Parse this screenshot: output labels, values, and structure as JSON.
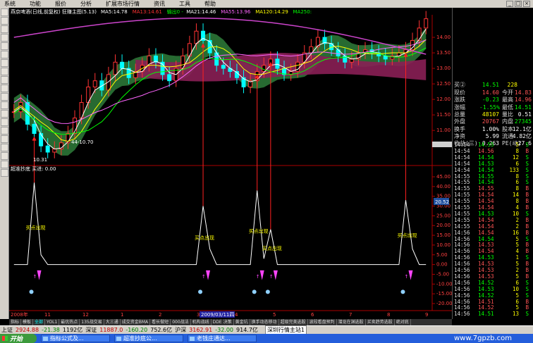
{
  "menu": {
    "items": [
      "系统",
      "功能",
      "报价",
      "分析",
      "扩展市场行情",
      "资讯",
      "工具",
      "帮助"
    ]
  },
  "window_buttons": [
    "_",
    "□",
    "×"
  ],
  "main_chart": {
    "title": "燕京啤酒(日线,前复权) 狂赚主图(5.13)",
    "ma_legend": [
      {
        "label": "MA5:14.78",
        "color": "#ffffff"
      },
      {
        "label": "MA13:14.61",
        "color": "#ff3333"
      },
      {
        "label": "输出0 -",
        "color": "#00ff00"
      },
      {
        "label": "MA21:14.46",
        "color": "#ffffff"
      },
      {
        "label": "MA55:13.96",
        "color": "#ff66ff"
      },
      {
        "label": "MA120:14.29",
        "color": "#ffff00"
      },
      {
        "label": "MA250:",
        "color": "#00ff00"
      }
    ],
    "annotation_low": "44-10.70",
    "annotation_low2": "10.31",
    "price_axis": [
      "14.00",
      "13.50",
      "13.00",
      "12.50",
      "12.00",
      "11.50",
      "11.00",
      "10.50"
    ]
  },
  "indicator": {
    "title": "超准抄底 买进: 0.00",
    "signal_label": "买点出现",
    "axis": [
      "45.00",
      "40.00",
      "35.00",
      "30.00",
      "25.00",
      "20.00",
      "15.00",
      "10.00",
      "5.00",
      "0.00",
      "-5.00",
      "-10.00",
      "-15.00",
      "-20.00"
    ],
    "current_value": "20.52"
  },
  "date_axis": {
    "left_label": "2008年",
    "months": [
      "11",
      "12",
      "1",
      "2",
      "3",
      "4",
      "5",
      "6",
      "7",
      "8",
      "9"
    ],
    "cursor_date": "2009/03/11四"
  },
  "quote": {
    "bid_label": "买②",
    "bid_price": "14.51",
    "bid_vol": "228",
    "rows": [
      {
        "l1": "现价",
        "v1": "14.60",
        "c1": "#ff5555",
        "l2": "今开",
        "v2": "14.83",
        "c2": "#ff5555"
      },
      {
        "l1": "涨跌",
        "v1": "-0.23",
        "c1": "#00ff00",
        "l2": "最高",
        "v2": "14.96",
        "c2": "#ff5555"
      },
      {
        "l1": "涨幅",
        "v1": "-1.55%",
        "c1": "#00ff00",
        "l2": "最低",
        "v2": "14.51",
        "c2": "#00ff00"
      },
      {
        "l1": "总量",
        "v1": "48107",
        "c1": "#ffff00",
        "l2": "量比",
        "v2": "0.51",
        "c2": "#ffffff"
      },
      {
        "l1": "外盘",
        "v1": "20767",
        "c1": "#ff5555",
        "l2": "内盘",
        "v2": "27345",
        "c2": "#00ff00"
      },
      {
        "l1": "换手",
        "v1": "1.00%",
        "c1": "#ffffff",
        "l2": "股本",
        "v2": "12.1亿",
        "c2": "#ffffff"
      },
      {
        "l1": "净资",
        "v1": "5.99",
        "c1": "#ffffff",
        "l2": "流通",
        "v2": "4.82亿",
        "c2": "#ffffff"
      },
      {
        "l1": "收益(三)",
        "v1": "0.263",
        "c1": "#ffffff",
        "l2": "PE(动)",
        "v2": "27.6",
        "c2": "#ffffff"
      }
    ],
    "ticks": [
      {
        "t": "14:54",
        "p": "14.55",
        "v": "5",
        "bs": "S",
        "c": "#00ff00"
      },
      {
        "t": "14:54",
        "p": "14.56",
        "v": "8",
        "bs": "B",
        "c": "#ff5555"
      },
      {
        "t": "14:54",
        "p": "14.54",
        "v": "12",
        "bs": "S",
        "c": "#00ff00"
      },
      {
        "t": "14:54",
        "p": "14.53",
        "v": "6",
        "bs": "S",
        "c": "#00ff00"
      },
      {
        "t": "14:54",
        "p": "14.54",
        "v": "133",
        "bs": "S",
        "c": "#00ff00"
      },
      {
        "t": "14:55",
        "p": "14.55",
        "v": "8",
        "bs": "S",
        "c": "#00ff00"
      },
      {
        "t": "14:55",
        "p": "14.54",
        "v": "6",
        "bs": "S",
        "c": "#00ff00"
      },
      {
        "t": "14:55",
        "p": "14.55",
        "v": "8",
        "bs": "B",
        "c": "#ff5555"
      },
      {
        "t": "14:55",
        "p": "14.54",
        "v": "14",
        "bs": "B",
        "c": "#ff5555"
      },
      {
        "t": "14:55",
        "p": "14.54",
        "v": "8",
        "bs": "B",
        "c": "#ff5555"
      },
      {
        "t": "14:55",
        "p": "14.54",
        "v": "4",
        "bs": "B",
        "c": "#ff5555"
      },
      {
        "t": "14:55",
        "p": "14.53",
        "v": "10",
        "bs": "S",
        "c": "#00ff00"
      },
      {
        "t": "14:55",
        "p": "14.54",
        "v": "2",
        "bs": "B",
        "c": "#ff5555"
      },
      {
        "t": "14:55",
        "p": "14.54",
        "v": "2",
        "bs": "B",
        "c": "#ff5555"
      },
      {
        "t": "14:56",
        "p": "14.54",
        "v": "16",
        "bs": "B",
        "c": "#ff5555"
      },
      {
        "t": "14:56",
        "p": "14.54",
        "v": "5",
        "bs": "S",
        "c": "#00ff00"
      },
      {
        "t": "14:56",
        "p": "14.53",
        "v": "5",
        "bs": "B",
        "c": "#ff5555"
      },
      {
        "t": "14:56",
        "p": "14.54",
        "v": "4",
        "bs": "B",
        "c": "#ff5555"
      },
      {
        "t": "14:56",
        "p": "14.53",
        "v": "1",
        "bs": "S",
        "c": "#00ff00"
      },
      {
        "t": "14:56",
        "p": "14.53",
        "v": "5",
        "bs": "B",
        "c": "#ff5555"
      },
      {
        "t": "14:56",
        "p": "14.53",
        "v": "2",
        "bs": "B",
        "c": "#ff5555"
      },
      {
        "t": "14:56",
        "p": "14.53",
        "v": "5",
        "bs": "B",
        "c": "#ff5555"
      },
      {
        "t": "14:56",
        "p": "14.52",
        "v": "6",
        "bs": "S",
        "c": "#00ff00"
      },
      {
        "t": "14:56",
        "p": "14.53",
        "v": "10",
        "bs": "S",
        "c": "#00ff00"
      },
      {
        "t": "14:56",
        "p": "14.52",
        "v": "5",
        "bs": "S",
        "c": "#00ff00"
      },
      {
        "t": "14:56",
        "p": "14.51",
        "v": "6",
        "bs": "B",
        "c": "#ff5555"
      },
      {
        "t": "14:56",
        "p": "14.52",
        "v": "5",
        "bs": "B",
        "c": "#ff5555"
      },
      {
        "t": "14:56",
        "p": "14.51",
        "v": "13",
        "bs": "S",
        "c": "#00ff00"
      }
    ]
  },
  "tabs": [
    "指标",
    "模板",
    "全部",
    "YOL1",
    "最优热点",
    "135战交易",
    "大三通",
    "成交资金BMA",
    "看长做短",
    "000战法",
    "机构战线",
    "DDE 决策",
    "黄金坑",
    "换手动态移动",
    "超级完美选股",
    "波段看盘预判",
    "潜龙在渊选股",
    "买卖趋势选股",
    "绝对底"
  ],
  "active_tab": "全部",
  "status": {
    "sh_label": "上证",
    "sh_val": "2924.88",
    "sh_chg": "-21.38",
    "sh_amt": "1192亿",
    "sz_label": "深证",
    "sz_val": "11887.0",
    "sz_chg": "-160.20",
    "sz_amt": "752.6亿",
    "hs_label": "沪深",
    "hs_val": "3162.91",
    "hs_chg": "-32.00",
    "hs_amt": "914.7亿",
    "box_text": "深圳行情主站1"
  },
  "taskbar": {
    "start_label": "开始",
    "tasks": [
      "指标公式及...",
      "超准抄底公...",
      "老钱庄通达..."
    ],
    "watermark": "www.7gpzb.com"
  },
  "colors": {
    "up": "#ff3333",
    "down": "#00ffff",
    "ma_green": "#2e8b3e",
    "ma_magenta": "#aa2060"
  },
  "chart_data": {
    "type": "line",
    "candles_n": 62,
    "price_series": [
      11.6,
      11.9,
      11.2,
      10.9,
      10.5,
      10.3,
      10.4,
      10.6,
      10.9,
      11.4,
      11.9,
      12.4,
      12.6,
      12.3,
      12.8,
      13.2,
      13.0,
      12.7,
      12.9,
      13.1,
      13.4,
      13.2,
      12.8,
      12.6,
      13.0,
      13.4,
      13.8,
      14.2,
      13.9,
      13.5,
      13.1,
      13.0,
      12.9,
      12.7,
      12.4,
      12.6,
      12.9,
      13.1,
      13.3,
      13.0,
      12.8,
      12.9,
      13.2,
      13.5,
      13.7,
      14.0,
      13.8,
      13.6,
      13.4,
      13.2,
      13.3,
      13.5,
      13.6,
      13.5,
      13.4,
      13.3,
      13.4,
      13.5,
      13.6,
      13.9,
      14.3,
      14.6
    ],
    "indicator_series": [
      0,
      0,
      0,
      42,
      5,
      0,
      0,
      0,
      0,
      0,
      0,
      0,
      0,
      0,
      0,
      0,
      0,
      0,
      0,
      0,
      0,
      0,
      0,
      0,
      0,
      0,
      0,
      0,
      30,
      8,
      0,
      0,
      0,
      0,
      0,
      0,
      38,
      3,
      18,
      0,
      0,
      0,
      0,
      0,
      0,
      0,
      0,
      0,
      0,
      0,
      0,
      0,
      0,
      0,
      0,
      0,
      0,
      0,
      33,
      8,
      0,
      0
    ],
    "signal_indices": [
      3,
      28,
      36,
      38,
      58
    ]
  }
}
